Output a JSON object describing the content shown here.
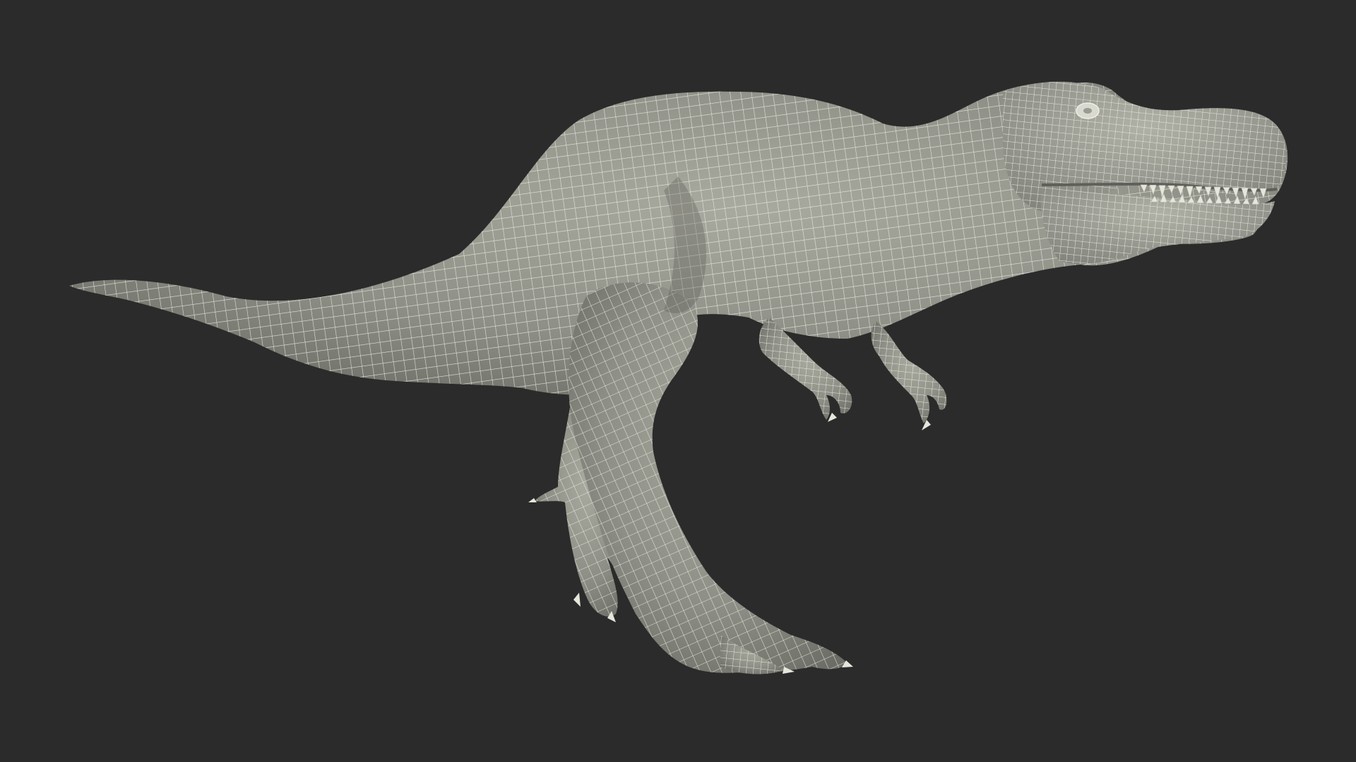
{
  "colors": {
    "background": "#2b2b2b",
    "mesh_fill": "#8e8f86",
    "mesh_light": "#a9aa9f",
    "mesh_shadow": "#6c6d66",
    "wire": "#eeeee6"
  }
}
